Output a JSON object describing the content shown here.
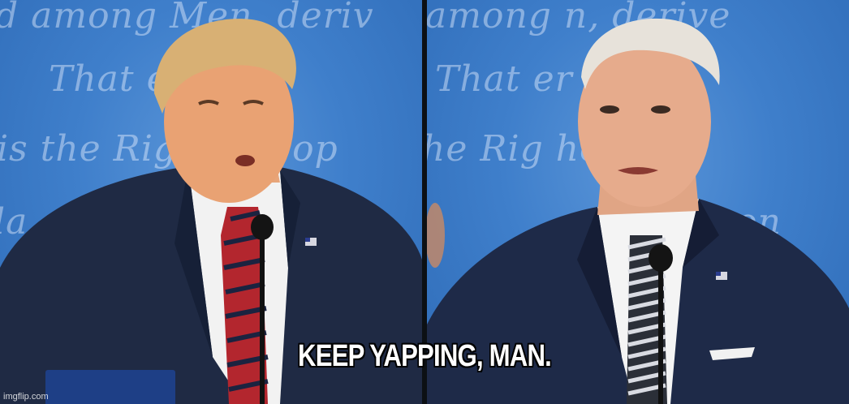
{
  "caption": "KEEP YAPPING, MAN.",
  "watermark": "imgflip.com",
  "colors": {
    "backdrop_blue": "#3f7fcb",
    "suit_navy": "#1f2a44",
    "shirt_white": "#f4f4f4",
    "tie_red": "#b3262e",
    "tie_navy": "#1b2340"
  }
}
